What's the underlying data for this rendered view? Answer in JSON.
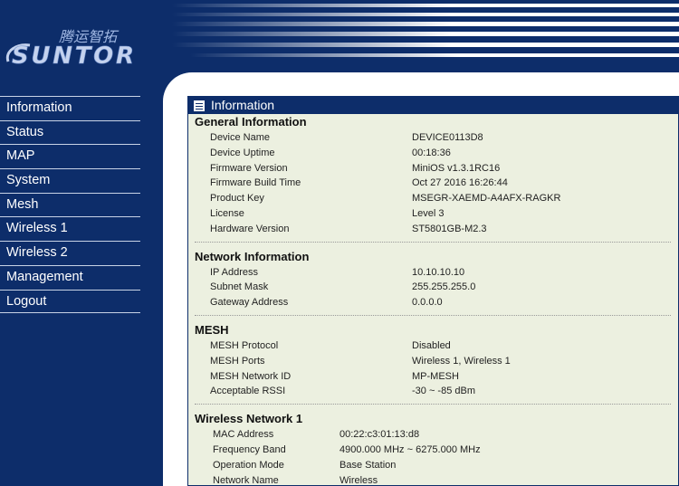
{
  "header": {
    "logo_cn": "腾运智拓",
    "logo_en": "SUNTOR"
  },
  "sidebar": {
    "items": [
      {
        "label": "Information"
      },
      {
        "label": "Status"
      },
      {
        "label": "MAP"
      },
      {
        "label": "System"
      },
      {
        "label": "Mesh"
      },
      {
        "label": "Wireless 1"
      },
      {
        "label": "Wireless 2"
      },
      {
        "label": "Management"
      },
      {
        "label": "Logout"
      }
    ]
  },
  "panel": {
    "title": "Information",
    "general": {
      "title": "General Information",
      "rows": [
        {
          "label": "Device Name",
          "value": "DEVICE0113D8"
        },
        {
          "label": "Device Uptime",
          "value": "00:18:36"
        },
        {
          "label": "Firmware Version",
          "value": "MiniOS v1.3.1RC16"
        },
        {
          "label": "Firmware Build Time",
          "value": "Oct 27 2016 16:26:44"
        },
        {
          "label": "Product Key",
          "value": "MSEGR-XAEMD-A4AFX-RAGKR"
        },
        {
          "label": "License",
          "value": "Level 3"
        },
        {
          "label": "Hardware Version",
          "value": "ST5801GB-M2.3"
        }
      ]
    },
    "network": {
      "title": "Network Information",
      "rows": [
        {
          "label": "IP Address",
          "value": "10.10.10.10"
        },
        {
          "label": "Subnet Mask",
          "value": "255.255.255.0"
        },
        {
          "label": "Gateway Address",
          "value": "0.0.0.0"
        }
      ]
    },
    "mesh": {
      "title": "MESH",
      "rows": [
        {
          "label": "MESH Protocol",
          "value": "Disabled"
        },
        {
          "label": "MESH Ports",
          "value": "Wireless 1, Wireless 1"
        },
        {
          "label": "MESH Network ID",
          "value": "MP-MESH"
        },
        {
          "label": "Acceptable RSSI",
          "value": "-30 ~ -85 dBm"
        }
      ]
    },
    "wireless1": {
      "title": "Wireless Network 1",
      "rows": [
        {
          "label": "MAC Address",
          "value": "00:22:c3:01:13:d8"
        },
        {
          "label": "Frequency Band",
          "value": "4900.000 MHz ~ 6275.000 MHz"
        },
        {
          "label": "Operation Mode",
          "value": "Base Station"
        },
        {
          "label": "Network Name",
          "value": "Wireless"
        }
      ]
    }
  },
  "colors": {
    "navy": "#0d2d6a",
    "panel_bg": "#ecf0e0",
    "logo_blue": "#8fa8d8"
  }
}
